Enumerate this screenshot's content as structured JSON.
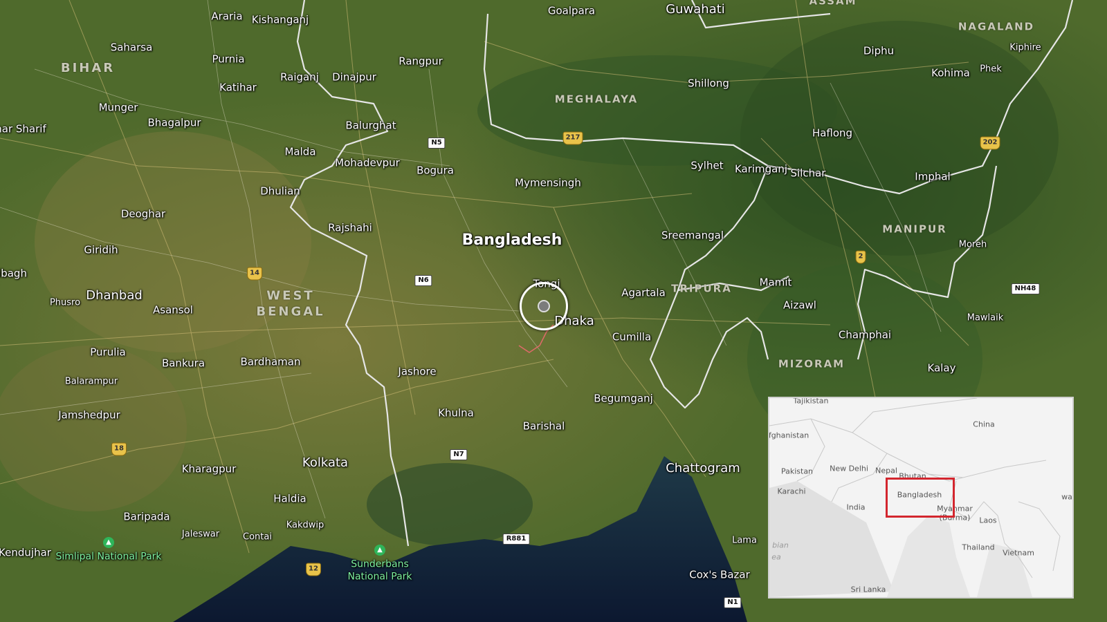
{
  "map": {
    "country_label": "Bangladesh",
    "capital_label": "Dhaka",
    "cities": [
      {
        "name": "Guwahati",
        "size": "med"
      },
      {
        "name": "Goalpara"
      },
      {
        "name": "Araria"
      },
      {
        "name": "Kishanganj"
      },
      {
        "name": "Saharsa"
      },
      {
        "name": "Purnia"
      },
      {
        "name": "Katihar"
      },
      {
        "name": "Raiganj"
      },
      {
        "name": "Dinajpur"
      },
      {
        "name": "Rangpur"
      },
      {
        "name": "Munger"
      },
      {
        "name": "Bhagalpur"
      },
      {
        "name": "har Sharif"
      },
      {
        "name": "Balurghat"
      },
      {
        "name": "Malda"
      },
      {
        "name": "Mohadevpur"
      },
      {
        "name": "Bogura"
      },
      {
        "name": "Dhulian"
      },
      {
        "name": "Deoghar"
      },
      {
        "name": "Rajshahi"
      },
      {
        "name": "Giridih"
      },
      {
        "name": "ibagh"
      },
      {
        "name": "Dhanbad",
        "size": "med"
      },
      {
        "name": "Phusro",
        "size": "sm"
      },
      {
        "name": "Asansol"
      },
      {
        "name": "Purulia"
      },
      {
        "name": "Bankura"
      },
      {
        "name": "Bardhaman"
      },
      {
        "name": "Balarampur",
        "size": "sm"
      },
      {
        "name": "Jamshedpur"
      },
      {
        "name": "Jashore"
      },
      {
        "name": "Khulna"
      },
      {
        "name": "Barishal"
      },
      {
        "name": "Kolkata",
        "size": "med"
      },
      {
        "name": "Kharagpur"
      },
      {
        "name": "Haldia"
      },
      {
        "name": "Kakdwip",
        "size": "sm"
      },
      {
        "name": "Baripada"
      },
      {
        "name": "Jaleswar",
        "size": "sm"
      },
      {
        "name": "Contai",
        "size": "sm"
      },
      {
        "name": "Kendujhar"
      },
      {
        "name": "Mymensingh"
      },
      {
        "name": "Tongi"
      },
      {
        "name": "Agartala"
      },
      {
        "name": "Cumilla"
      },
      {
        "name": "Begumganj"
      },
      {
        "name": "Chattogram",
        "size": "med"
      },
      {
        "name": "Lama",
        "size": "sm"
      },
      {
        "name": "Cox's Bazar"
      },
      {
        "name": "Sreemangal"
      },
      {
        "name": "Sylhet"
      },
      {
        "name": "Karimganj"
      },
      {
        "name": "Silchar"
      },
      {
        "name": "Shillong"
      },
      {
        "name": "Haflong"
      },
      {
        "name": "Diphu"
      },
      {
        "name": "Kohima"
      },
      {
        "name": "Phek",
        "size": "sm"
      },
      {
        "name": "Kiphire",
        "size": "sm"
      },
      {
        "name": "Imphal"
      },
      {
        "name": "Moreh",
        "size": "sm"
      },
      {
        "name": "Mamit"
      },
      {
        "name": "Aizawl"
      },
      {
        "name": "Champhai"
      },
      {
        "name": "Mawlaik",
        "size": "sm"
      },
      {
        "name": "Kalay"
      }
    ],
    "regions": [
      {
        "name": "BIHAR"
      },
      {
        "name": "WEST BENGAL",
        "size": "big"
      },
      {
        "name": "MEGHALAYA"
      },
      {
        "name": "TRIPURA"
      },
      {
        "name": "MANIPUR"
      },
      {
        "name": "MIZORAM"
      },
      {
        "name": "NAGALAND"
      },
      {
        "name": "ASSAM"
      }
    ],
    "parks": [
      {
        "name": "Simlipal National Park"
      },
      {
        "name": "Sunderbans National Park"
      }
    ],
    "road_shields": [
      {
        "label": "N5",
        "style": "white"
      },
      {
        "label": "N6",
        "style": "white"
      },
      {
        "label": "N7",
        "style": "white"
      },
      {
        "label": "R881",
        "style": "white"
      },
      {
        "label": "N1",
        "style": "white"
      },
      {
        "label": "NH48",
        "style": "white"
      },
      {
        "label": "217",
        "style": "yellow"
      },
      {
        "label": "202",
        "style": "yellow"
      },
      {
        "label": "14",
        "style": "yellow"
      },
      {
        "label": "18",
        "style": "yellow"
      },
      {
        "label": "12",
        "style": "yellow"
      },
      {
        "label": "2",
        "style": "yellow"
      }
    ],
    "colors": {
      "land": "#4f6a2c",
      "water": "#14243a",
      "border": "#e6e6e6",
      "inset_highlight": "#d3262e"
    }
  },
  "inset": {
    "labels": [
      {
        "name": "Tajikistan"
      },
      {
        "name": "China"
      },
      {
        "name": "fghanistan"
      },
      {
        "name": "Pakistan"
      },
      {
        "name": "New Delhi"
      },
      {
        "name": "Nepal"
      },
      {
        "name": "Bhutan"
      },
      {
        "name": "Karachi"
      },
      {
        "name": "Bangladesh"
      },
      {
        "name": "India"
      },
      {
        "name": "Myanmar"
      },
      {
        "name": "(Burma)"
      },
      {
        "name": "Laos"
      },
      {
        "name": "Thailand"
      },
      {
        "name": "Vietnam"
      },
      {
        "name": "Sri Lanka"
      },
      {
        "name": "bian"
      },
      {
        "name": "ea"
      },
      {
        "name": "wa"
      }
    ]
  }
}
